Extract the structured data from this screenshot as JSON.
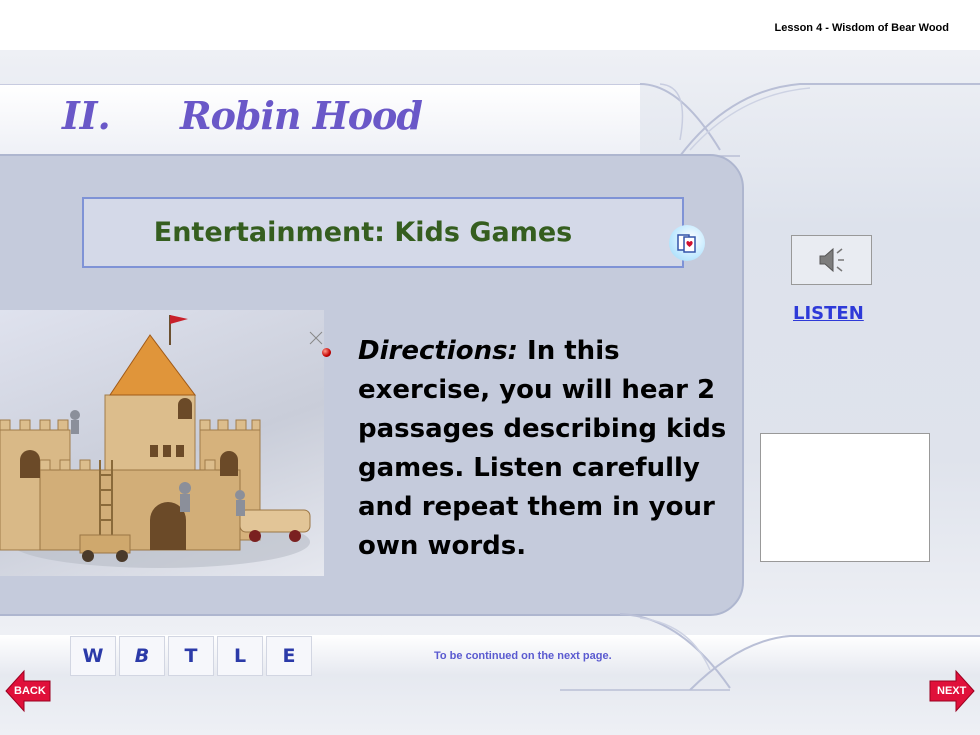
{
  "header": {
    "lesson_title": "Lesson 4 - Wisdom of Bear Wood"
  },
  "heading": {
    "number": "II.",
    "title": "Robin Hood"
  },
  "subtitle": {
    "text": "Entertainment: Kids Games"
  },
  "audio": {
    "listen_label": "LISTEN"
  },
  "directions": {
    "label": "Directions:",
    "text": "In this exercise, you will hear 2 passages describing kids games. Listen carefully and repeat them in your own words."
  },
  "nav": {
    "tabs": [
      {
        "label": "W"
      },
      {
        "label": "B"
      },
      {
        "label": "T"
      },
      {
        "label": "L"
      },
      {
        "label": "E"
      }
    ],
    "continued_text": "To be continued on the next page.",
    "back_label": "BACK",
    "next_label": "NEXT"
  },
  "colors": {
    "heading": "#6a58c8",
    "subtitle": "#355e1f",
    "link": "#2e3ad8",
    "panel": "#c5cbdc",
    "nav_arrow": "#e0103a"
  }
}
